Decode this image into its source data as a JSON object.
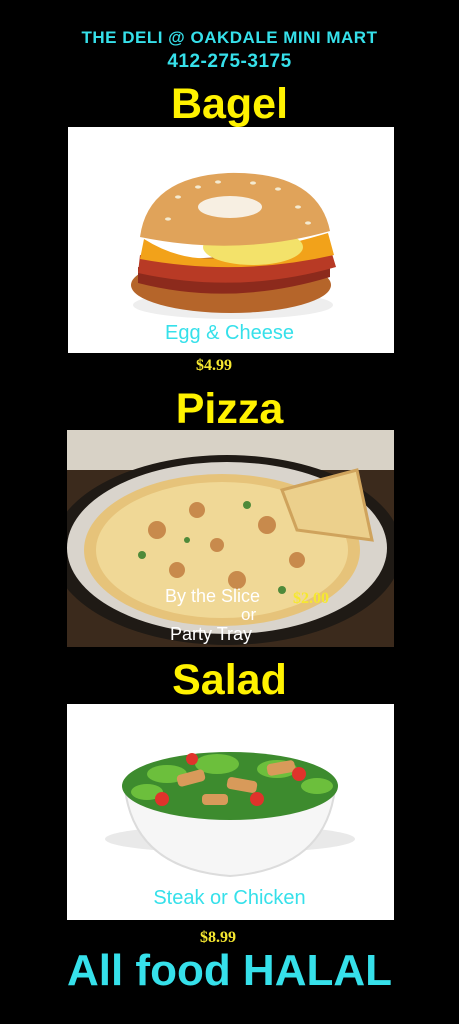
{
  "header": {
    "store_name": "THE DELI @ OAKDALE MINI MART",
    "phone": "412-275-3175"
  },
  "sections": [
    {
      "title": "Bagel",
      "image": "bagel-sandwich-photo",
      "caption": "Egg & Cheese",
      "price": "$4.99"
    },
    {
      "title": "Pizza",
      "image": "pizza-photo",
      "caption_line1": "By the Slice",
      "price": "$2.00",
      "caption_line2": "or",
      "caption_line3": "Party Tray"
    },
    {
      "title": "Salad",
      "image": "salad-bowl-photo",
      "caption": "Steak or Chicken",
      "price": "$8.99"
    }
  ],
  "footer": {
    "banner": "All food HALAL"
  },
  "colors": {
    "background": "#000000",
    "header_text": "#36e0ea",
    "title_text": "#fff200",
    "price_text": "#f6e830"
  }
}
